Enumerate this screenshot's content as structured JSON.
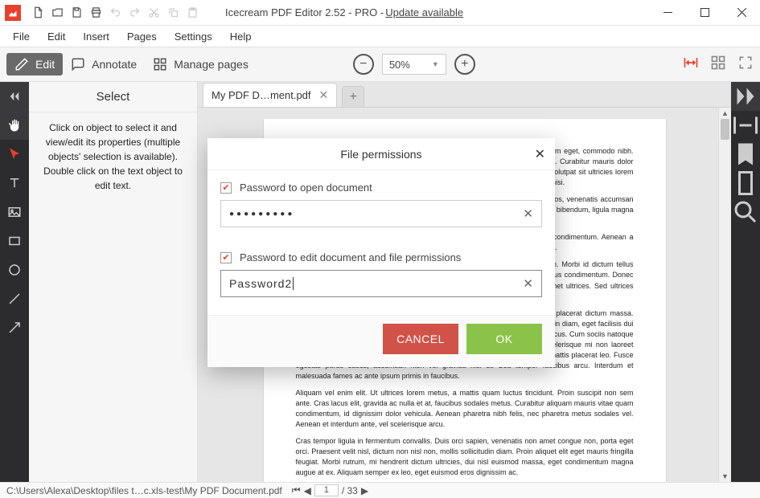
{
  "titlebar": {
    "app_name": "Icecream PDF Editor 2.52 - PRO - ",
    "update_link": "Update available"
  },
  "menubar": {
    "items": [
      "File",
      "Edit",
      "Insert",
      "Pages",
      "Settings",
      "Help"
    ]
  },
  "toolbar": {
    "edit_label": "Edit",
    "annotate_label": "Annotate",
    "manage_label": "Manage pages",
    "zoom_value": "50%"
  },
  "left_panel": {
    "title": "Select",
    "body": "Click on object to select it and view/edit its properties (multiple objects' selection is available). Double click on the text object to edit text."
  },
  "tabs": {
    "active": "My PDF D…ment.pdf"
  },
  "dialog": {
    "title": "File permissions",
    "open_check_label": "Password to open document",
    "open_value_masked": "●●●●●●●●●",
    "edit_check_label": "Password to edit document and file permissions",
    "edit_value": "Password2",
    "cancel": "CANCEL",
    "ok": "OK"
  },
  "statusbar": {
    "path": "C:\\Users\\Alexa\\Desktop\\files t…c.xls-test\\My PDF Document.pdf",
    "page_current": "1",
    "page_total": "/ 33"
  },
  "document": {
    "p1": "Lorem ipsum dolor sit amet, consectetur adipiscing elit. Nam sit amet odio diam eget, commodo nibh. Donec ligula augue, suscipit vel auctor eu, cursus suscipit, gravida vitae ligula. Curabitur mauris dolor facilisis at a ultrices. Proin mattis ex at nisi rutrum, id laoreet velit luctus. Duis volutpat sit ultricies lorem sed eget odio. Suspendisse sit amet tortor mi. Ut id lorem urna, non elementum nisi.",
    "p2": "Donec tristique arcu eu nisl luctus, in pellentesque nulla posuere. Sed tortor eros, venenatis accumsan maximus rutrum. Cras eget aliquet sed magna eu tortor hendrerit placerat. Etiam bibendum, ligula magna tortor.",
    "p3": "Class aptent taciti sociosqu ad litora torquent sapien praesent pretium luctus condimentum. Aenean a accumsan lectus, sed lacinia tellus ullamcorper cursus, pellentesque vel tincidunt.",
    "p4": "Sed vel tristique mauris. Donec scelerisque velit a nisl ullamcorper vestibulum. Morbi id dictum tellus nunc congue et nisi feugiat, mollis non justo et nisl, vitae placerat tortor. Vivamus condimentum. Donec lobortis scelerisque ullamcorper tortor et in metus pretium acuris. Nunc sit amet ultrices. Sed ultrices tempus dui, ac sapien metus.",
    "p5": "Cras pretium bibendum nibh et volutpat erat. Pellentesque vel erat, faucibus placerat dictum massa. Lorem ipsum dolor sit amet, consectetur adipiscing elit, malesuada sed sollicitudin diam, eget facilisis dui felis eget mi. Ut eu risus quis ligula gravida pretium. Ut aliquet nisl ac volutpat lacus. Cum sociis natoque penatibus et magnis dis parturient montes, nascetur ridiculus mus. Fusce scelerisque mi non laoreet ultrices. Morbi tempor arcu id quam bibendum, eu porta lorem venenatis. Sed mattis placerat leo. Fusce egestas purus cusus, accumsan nibh vel gravida nisl ut. Sed tempor faucibus arcu. Interdum et malesuada fames ac ante ipsum primis in faucibus.",
    "p6": "Aliquam vel enim elit. Ut ultrices lorem metus, a mattis quam luctus tincidunt. Proin suscipit non sem ante. Cras lacus elit, gravida ac nulla et at, faucibus sodales metus. Curabitur aliquam mauris vitae quam condimentum, id dignissim dolor vehicula. Aenean pharetra nibh felis, nec pharetra metus sodales vel. Aenean et interdum ante, vel scelerisque arcu.",
    "p7": "Cras tempor ligula in fermentum convallis. Duis orci sapien, venenatis non amet congue non, porta eget orci. Praesent velit nisl, dictum non nisl non, mollis sollicitudin diam. Proin aliquet elit eget mauris fringilla feugiat. Morbi rutrum, mi hendrerit dictum ultricies, dui nisl euismod massa, eget condimentum magna augue at ex. Aliquam semper ex leo, eget euismod eros dignissim ac."
  }
}
